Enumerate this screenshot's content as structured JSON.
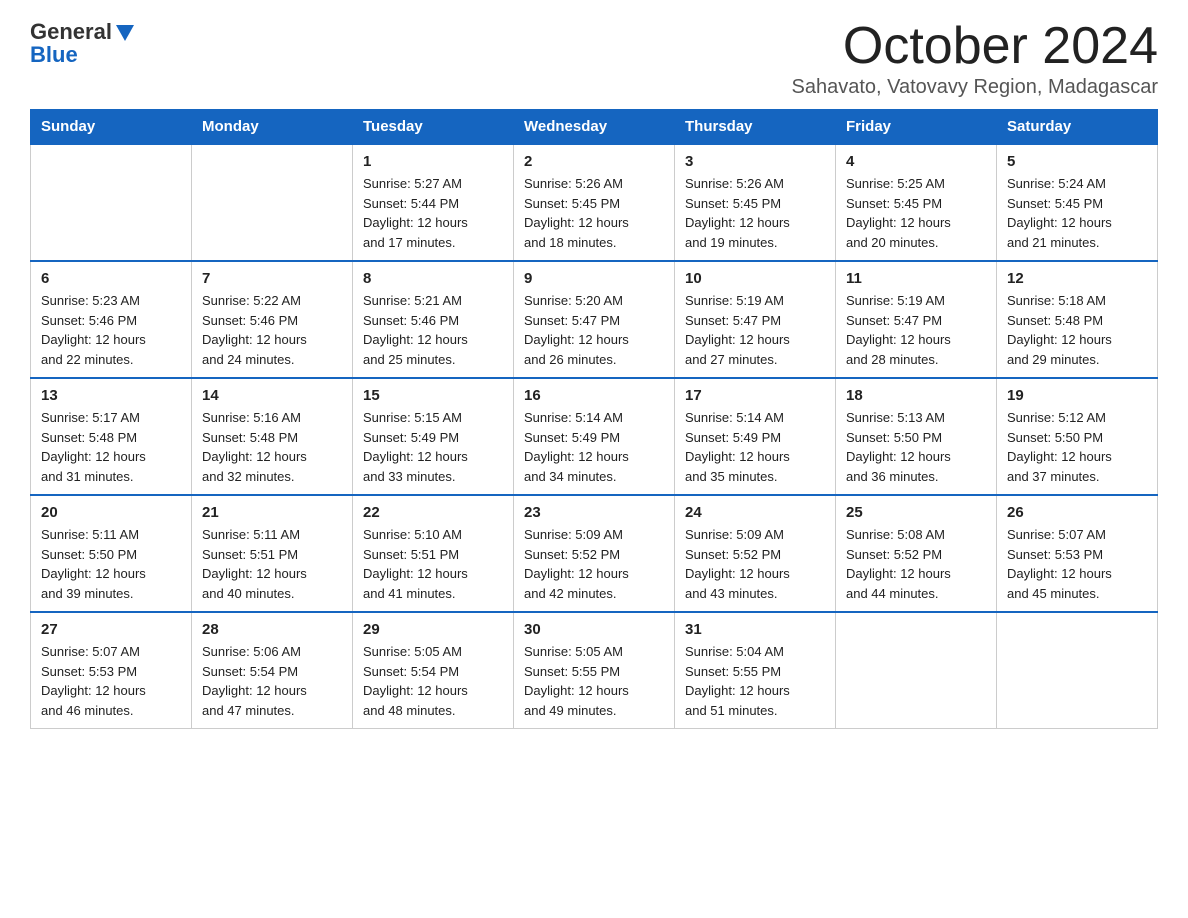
{
  "header": {
    "logo_general": "General",
    "logo_blue": "Blue",
    "month_title": "October 2024",
    "location": "Sahavato, Vatovavy Region, Madagascar"
  },
  "weekdays": [
    "Sunday",
    "Monday",
    "Tuesday",
    "Wednesday",
    "Thursday",
    "Friday",
    "Saturday"
  ],
  "weeks": [
    [
      {
        "day": "",
        "info": ""
      },
      {
        "day": "",
        "info": ""
      },
      {
        "day": "1",
        "info": "Sunrise: 5:27 AM\nSunset: 5:44 PM\nDaylight: 12 hours\nand 17 minutes."
      },
      {
        "day": "2",
        "info": "Sunrise: 5:26 AM\nSunset: 5:45 PM\nDaylight: 12 hours\nand 18 minutes."
      },
      {
        "day": "3",
        "info": "Sunrise: 5:26 AM\nSunset: 5:45 PM\nDaylight: 12 hours\nand 19 minutes."
      },
      {
        "day": "4",
        "info": "Sunrise: 5:25 AM\nSunset: 5:45 PM\nDaylight: 12 hours\nand 20 minutes."
      },
      {
        "day": "5",
        "info": "Sunrise: 5:24 AM\nSunset: 5:45 PM\nDaylight: 12 hours\nand 21 minutes."
      }
    ],
    [
      {
        "day": "6",
        "info": "Sunrise: 5:23 AM\nSunset: 5:46 PM\nDaylight: 12 hours\nand 22 minutes."
      },
      {
        "day": "7",
        "info": "Sunrise: 5:22 AM\nSunset: 5:46 PM\nDaylight: 12 hours\nand 24 minutes."
      },
      {
        "day": "8",
        "info": "Sunrise: 5:21 AM\nSunset: 5:46 PM\nDaylight: 12 hours\nand 25 minutes."
      },
      {
        "day": "9",
        "info": "Sunrise: 5:20 AM\nSunset: 5:47 PM\nDaylight: 12 hours\nand 26 minutes."
      },
      {
        "day": "10",
        "info": "Sunrise: 5:19 AM\nSunset: 5:47 PM\nDaylight: 12 hours\nand 27 minutes."
      },
      {
        "day": "11",
        "info": "Sunrise: 5:19 AM\nSunset: 5:47 PM\nDaylight: 12 hours\nand 28 minutes."
      },
      {
        "day": "12",
        "info": "Sunrise: 5:18 AM\nSunset: 5:48 PM\nDaylight: 12 hours\nand 29 minutes."
      }
    ],
    [
      {
        "day": "13",
        "info": "Sunrise: 5:17 AM\nSunset: 5:48 PM\nDaylight: 12 hours\nand 31 minutes."
      },
      {
        "day": "14",
        "info": "Sunrise: 5:16 AM\nSunset: 5:48 PM\nDaylight: 12 hours\nand 32 minutes."
      },
      {
        "day": "15",
        "info": "Sunrise: 5:15 AM\nSunset: 5:49 PM\nDaylight: 12 hours\nand 33 minutes."
      },
      {
        "day": "16",
        "info": "Sunrise: 5:14 AM\nSunset: 5:49 PM\nDaylight: 12 hours\nand 34 minutes."
      },
      {
        "day": "17",
        "info": "Sunrise: 5:14 AM\nSunset: 5:49 PM\nDaylight: 12 hours\nand 35 minutes."
      },
      {
        "day": "18",
        "info": "Sunrise: 5:13 AM\nSunset: 5:50 PM\nDaylight: 12 hours\nand 36 minutes."
      },
      {
        "day": "19",
        "info": "Sunrise: 5:12 AM\nSunset: 5:50 PM\nDaylight: 12 hours\nand 37 minutes."
      }
    ],
    [
      {
        "day": "20",
        "info": "Sunrise: 5:11 AM\nSunset: 5:50 PM\nDaylight: 12 hours\nand 39 minutes."
      },
      {
        "day": "21",
        "info": "Sunrise: 5:11 AM\nSunset: 5:51 PM\nDaylight: 12 hours\nand 40 minutes."
      },
      {
        "day": "22",
        "info": "Sunrise: 5:10 AM\nSunset: 5:51 PM\nDaylight: 12 hours\nand 41 minutes."
      },
      {
        "day": "23",
        "info": "Sunrise: 5:09 AM\nSunset: 5:52 PM\nDaylight: 12 hours\nand 42 minutes."
      },
      {
        "day": "24",
        "info": "Sunrise: 5:09 AM\nSunset: 5:52 PM\nDaylight: 12 hours\nand 43 minutes."
      },
      {
        "day": "25",
        "info": "Sunrise: 5:08 AM\nSunset: 5:52 PM\nDaylight: 12 hours\nand 44 minutes."
      },
      {
        "day": "26",
        "info": "Sunrise: 5:07 AM\nSunset: 5:53 PM\nDaylight: 12 hours\nand 45 minutes."
      }
    ],
    [
      {
        "day": "27",
        "info": "Sunrise: 5:07 AM\nSunset: 5:53 PM\nDaylight: 12 hours\nand 46 minutes."
      },
      {
        "day": "28",
        "info": "Sunrise: 5:06 AM\nSunset: 5:54 PM\nDaylight: 12 hours\nand 47 minutes."
      },
      {
        "day": "29",
        "info": "Sunrise: 5:05 AM\nSunset: 5:54 PM\nDaylight: 12 hours\nand 48 minutes."
      },
      {
        "day": "30",
        "info": "Sunrise: 5:05 AM\nSunset: 5:55 PM\nDaylight: 12 hours\nand 49 minutes."
      },
      {
        "day": "31",
        "info": "Sunrise: 5:04 AM\nSunset: 5:55 PM\nDaylight: 12 hours\nand 51 minutes."
      },
      {
        "day": "",
        "info": ""
      },
      {
        "day": "",
        "info": ""
      }
    ]
  ]
}
